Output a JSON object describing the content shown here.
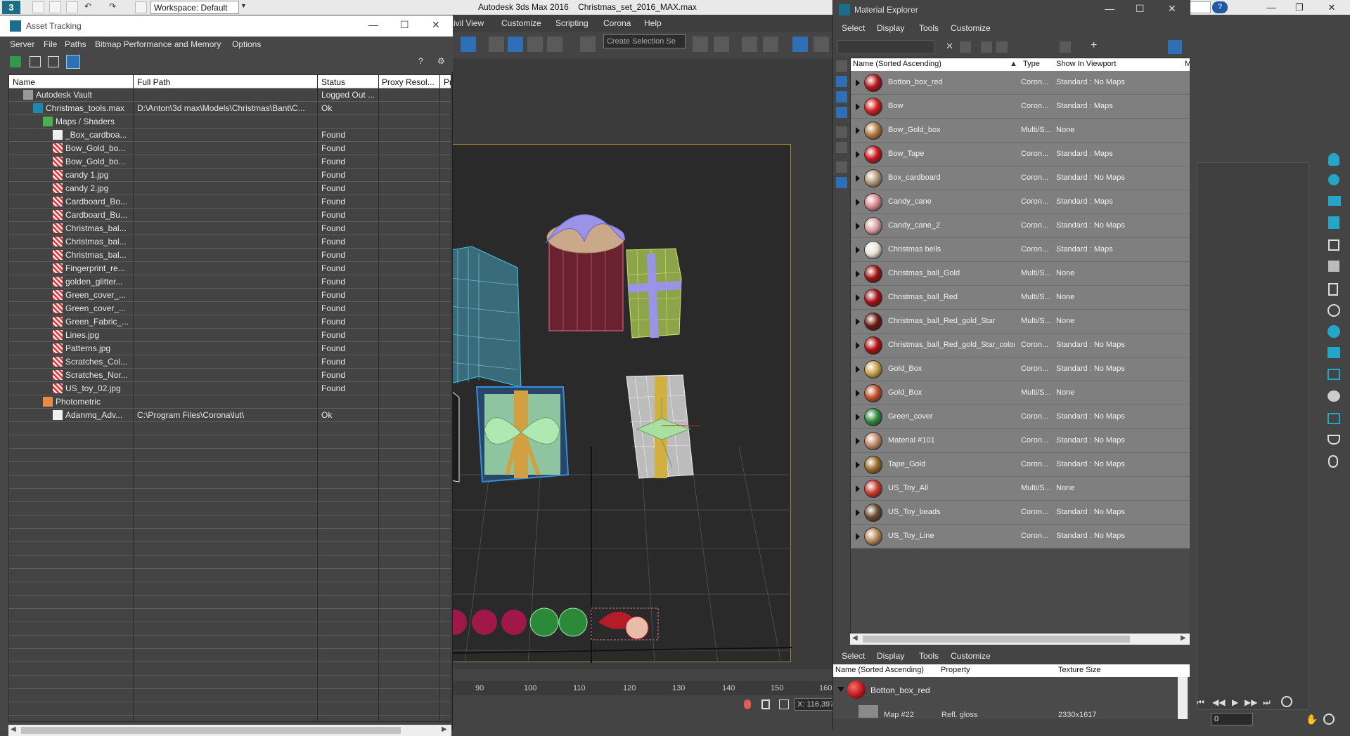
{
  "titlebar": {
    "workspace": "Workspace: Default",
    "app_title": "Autodesk 3ds Max 2016",
    "file_name": "Christmas_set_2016_MAX.max"
  },
  "main_menu": [
    "ivil View",
    "Customize",
    "Scripting",
    "Corona",
    "Help"
  ],
  "toolbar": {
    "selection_set_placeholder": "Create Selection Se"
  },
  "timeline": {
    "ticks": [
      "90",
      "100",
      "110",
      "120",
      "130",
      "140",
      "150",
      "160"
    ],
    "x_readout": "116,397"
  },
  "asset_tracking": {
    "title": "Asset Tracking",
    "menu": [
      "Server",
      "File",
      "Paths",
      "Bitmap Performance and Memory",
      "Options"
    ],
    "columns": [
      "Name",
      "Full Path",
      "Status",
      "Proxy Resol...",
      "Pr"
    ],
    "rows": [
      {
        "name": "Autodesk Vault",
        "path": "",
        "status": "Logged Out ...",
        "level": 1,
        "icon": "vault-icon"
      },
      {
        "name": "Christmas_tools.max",
        "path": "D:\\Anton\\3d max\\Models\\Christmas\\Bant\\C...",
        "status": "Ok",
        "level": 2,
        "icon": "max-file-icon"
      },
      {
        "name": "Maps / Shaders",
        "path": "",
        "status": "",
        "level": 3,
        "icon": "maps-folder-icon"
      },
      {
        "name": "_Box_cardboa...",
        "path": "",
        "status": "Found",
        "level": 4,
        "icon": "image-file-icon"
      },
      {
        "name": "Bow_Gold_bo...",
        "path": "",
        "status": "Found",
        "level": 4,
        "icon": "bitmap-icon"
      },
      {
        "name": "Bow_Gold_bo...",
        "path": "",
        "status": "Found",
        "level": 4,
        "icon": "bitmap-icon"
      },
      {
        "name": "candy 1.jpg",
        "path": "",
        "status": "Found",
        "level": 4,
        "icon": "bitmap-icon"
      },
      {
        "name": "candy 2.jpg",
        "path": "",
        "status": "Found",
        "level": 4,
        "icon": "bitmap-icon"
      },
      {
        "name": "Cardboard_Bo...",
        "path": "",
        "status": "Found",
        "level": 4,
        "icon": "bitmap-icon"
      },
      {
        "name": "Cardboard_Bu...",
        "path": "",
        "status": "Found",
        "level": 4,
        "icon": "bitmap-icon"
      },
      {
        "name": "Christmas_bal...",
        "path": "",
        "status": "Found",
        "level": 4,
        "icon": "bitmap-icon"
      },
      {
        "name": "Christmas_bal...",
        "path": "",
        "status": "Found",
        "level": 4,
        "icon": "bitmap-icon"
      },
      {
        "name": "Christmas_bal...",
        "path": "",
        "status": "Found",
        "level": 4,
        "icon": "bitmap-icon"
      },
      {
        "name": "Fingerprint_re...",
        "path": "",
        "status": "Found",
        "level": 4,
        "icon": "bitmap-icon"
      },
      {
        "name": "golden_glitter...",
        "path": "",
        "status": "Found",
        "level": 4,
        "icon": "bitmap-icon"
      },
      {
        "name": "Green_cover_...",
        "path": "",
        "status": "Found",
        "level": 4,
        "icon": "bitmap-icon"
      },
      {
        "name": "Green_cover_...",
        "path": "",
        "status": "Found",
        "level": 4,
        "icon": "bitmap-icon"
      },
      {
        "name": "Green_Fabric_...",
        "path": "",
        "status": "Found",
        "level": 4,
        "icon": "bitmap-icon"
      },
      {
        "name": "Lines.jpg",
        "path": "",
        "status": "Found",
        "level": 4,
        "icon": "bitmap-icon"
      },
      {
        "name": "Patterns.jpg",
        "path": "",
        "status": "Found",
        "level": 4,
        "icon": "bitmap-icon"
      },
      {
        "name": "Scratches_Col...",
        "path": "",
        "status": "Found",
        "level": 4,
        "icon": "bitmap-icon"
      },
      {
        "name": "Scratches_Nor...",
        "path": "",
        "status": "Found",
        "level": 4,
        "icon": "bitmap-icon"
      },
      {
        "name": "US_toy_02.jpg",
        "path": "",
        "status": "Found",
        "level": 4,
        "icon": "bitmap-icon"
      },
      {
        "name": "Photometric",
        "path": "",
        "status": "",
        "level": 3,
        "icon": "photometric-icon"
      },
      {
        "name": "Adanmq_Adv...",
        "path": "C:\\Program Files\\Corona\\lut\\",
        "status": "Ok",
        "level": 4,
        "icon": "image-file-icon"
      }
    ]
  },
  "material_explorer": {
    "title": "Material Explorer",
    "menu": [
      "Select",
      "Display",
      "Tools",
      "Customize"
    ],
    "columns": [
      "Name (Sorted Ascending)",
      "Type",
      "Show In Viewport",
      "M"
    ],
    "rows": [
      {
        "name": "Botton_box_red",
        "type": "Coron...",
        "viewport": "Standard : No Maps",
        "color": "#b3151a"
      },
      {
        "name": "Bow",
        "type": "Coron...",
        "viewport": "Standard : Maps",
        "color": "#d01e1e"
      },
      {
        "name": "Bow_Gold_box",
        "type": "Multi/S...",
        "viewport": "None",
        "color": "#b07a45"
      },
      {
        "name": "Bow_Tape",
        "type": "Coron...",
        "viewport": "Standard : Maps",
        "color": "#c8181c"
      },
      {
        "name": "Box_cardboard",
        "type": "Coron...",
        "viewport": "Standard : No Maps",
        "color": "#b69a7a"
      },
      {
        "name": "Candy_cane",
        "type": "Coron...",
        "viewport": "Standard : Maps",
        "color": "#d98a8f"
      },
      {
        "name": "Candy_cane_2",
        "type": "Coron...",
        "viewport": "Standard : No Maps",
        "color": "#d9a0a0"
      },
      {
        "name": "Christmas bells",
        "type": "Coron...",
        "viewport": "Standard : Maps",
        "color": "#e8e1d6"
      },
      {
        "name": "Christmas_ball_Gold",
        "type": "Multi/S...",
        "viewport": "None",
        "color": "#9b1510"
      },
      {
        "name": "Christmas_ball_Red",
        "type": "Multi/S...",
        "viewport": "None",
        "color": "#a51014"
      },
      {
        "name": "Christmas_ball_Red_gold_Star",
        "type": "Multi/S...",
        "viewport": "None",
        "color": "#6a1a12"
      },
      {
        "name": "Christmas_ball_Red_gold_Star_color",
        "type": "Coron...",
        "viewport": "Standard : No Maps",
        "color": "#b01010"
      },
      {
        "name": "Gold_Box",
        "type": "Coron...",
        "viewport": "Standard : No Maps",
        "color": "#c9a24a"
      },
      {
        "name": "Gold_Box",
        "type": "Multi/S...",
        "viewport": "None",
        "color": "#c0502a"
      },
      {
        "name": "Green_cover",
        "type": "Coron...",
        "viewport": "Standard : No Maps",
        "color": "#2e8a3e"
      },
      {
        "name": "Material #101",
        "type": "Coron...",
        "viewport": "Standard : No Maps",
        "color": "#c08a6a"
      },
      {
        "name": "Tape_Gold",
        "type": "Coron...",
        "viewport": "Standard : No Maps",
        "color": "#9c6a2a"
      },
      {
        "name": "US_Toy_All",
        "type": "Multi/S...",
        "viewport": "None",
        "color": "#c83a2a"
      },
      {
        "name": "US_Toy_beads",
        "type": "Coron...",
        "viewport": "Standard : No Maps",
        "color": "#6a4a30"
      },
      {
        "name": "US_Toy_Line",
        "type": "Coron...",
        "viewport": "Standard : No Maps",
        "color": "#b5895a"
      }
    ],
    "bottom_menu": [
      "Select",
      "Display",
      "Tools",
      "Customize"
    ],
    "bottom_columns": [
      "Name (Sorted Ascending)",
      "Property",
      "Texture Size"
    ],
    "bottom_row": {
      "name": "Botton_box_red"
    },
    "bottom_partial": {
      "name": "Map #22",
      "property": "Refl. gloss",
      "size": "2330x1617"
    }
  },
  "anim_controls": {
    "frame": "0"
  }
}
